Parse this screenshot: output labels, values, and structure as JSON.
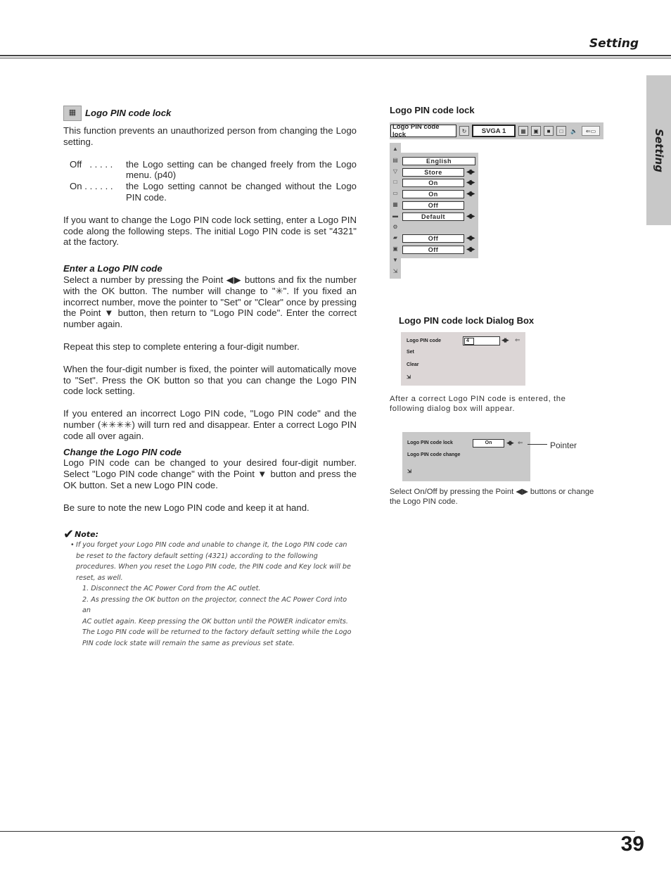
{
  "header": {
    "section_title": "Setting"
  },
  "side_tab": {
    "label": "Setting"
  },
  "left": {
    "section": {
      "icon": "logo-pin-lock-icon",
      "title": "Logo PIN code lock",
      "intro": "This function prevents an unauthorized person from changing the Logo setting.",
      "options": [
        {
          "key": "Off   . . . . .",
          "desc": "the Logo setting can be changed freely from the Logo menu.  (p40)"
        },
        {
          "key": "On . . . . . .",
          "desc": "the Logo setting cannot be changed without the Logo PIN code."
        }
      ],
      "para2": "If you want to change the Logo PIN code lock setting, enter a Logo PIN code along the following steps. The initial Logo PIN code is set \"4321\" at the factory."
    },
    "enter": {
      "title": "Enter a Logo PIN code",
      "p1": "Select a number by pressing the Point ◀▶ buttons and fix the number with the OK button.  The number will change to \"✳\".  If you fixed an incorrect number, move the pointer to \"Set\" or \"Clear\" once by pressing the Point ▼ button, then return to \"Logo PIN code\".  Enter the correct number again.",
      "p2": "Repeat this step to complete entering a four-digit number.",
      "p3": "When the four-digit number is fixed, the pointer will automatically move to \"Set\".  Press the OK button so that you can change the Logo PIN code lock setting.",
      "p4": "If you entered an incorrect Logo PIN code, \"Logo PIN code\" and the number (✳✳✳✳) will turn red and disappear.  Enter a correct Logo PIN code all over again."
    },
    "change": {
      "title": "Change the Logo PIN code",
      "p1": "Logo PIN code can be changed to your desired four-digit number. Select \"Logo PIN code change\" with the Point ▼ button and press the OK button. Set a new Logo PIN code.",
      "p2": "Be sure to note the new Logo PIN code and keep it at hand."
    },
    "note": {
      "title": "Note:",
      "bullet": "If you forget your Logo PIN code and unable to change it, the Logo PIN code can be reset to the factory default setting (4321) according to the following procedures. When you reset the Logo PIN code, the PIN code and Key lock will be reset, as well.",
      "step1": "1. Disconnect the AC Power Cord from the AC outlet.",
      "step2a": "2. As pressing the OK button on the projector, connect the AC Power Cord into an",
      "step2b": "AC outlet again.  Keep pressing the OK button until the POWER indicator emits.",
      "step2c": "The Logo PIN code will be returned to the factory default setting while the Logo PIN code lock state will remain the same as previous set state."
    }
  },
  "right": {
    "menu_label": "Logo PIN code lock",
    "menubar": {
      "selected_item": "Logo PIN code lock",
      "source": "SVGA 1",
      "icons": [
        "pc-adjust-icon",
        "image-select-icon",
        "image-adjust-icon",
        "screen-icon",
        "setting-icon",
        "sound-icon",
        "setting-selected-icon"
      ]
    },
    "submenu": {
      "rows": [
        {
          "icon": "▲",
          "value": null,
          "arrows": false
        },
        {
          "icon": "▤",
          "value": "English",
          "arrows": false
        },
        {
          "icon": "▽",
          "value": "Store",
          "arrows": true
        },
        {
          "icon": "□",
          "value": "On",
          "arrows": true
        },
        {
          "icon": "▭",
          "value": "On",
          "arrows": true
        },
        {
          "icon": "▦",
          "value": "Off",
          "arrows": false
        },
        {
          "icon": "▬",
          "value": "Default",
          "arrows": true
        },
        {
          "icon": "⚙",
          "value": null,
          "arrows": false
        },
        {
          "icon": "▰",
          "value": "Off",
          "arrows": true
        },
        {
          "icon": "▣",
          "value": "Off",
          "arrows": true
        },
        {
          "icon": "▼",
          "value": null,
          "arrows": false
        },
        {
          "icon": "⇲",
          "value": null,
          "arrows": false
        }
      ]
    },
    "dialog_label": "Logo PIN code lock Dialog Box",
    "dialog1": {
      "field_label": "Logo PIN code",
      "field_value": "4",
      "set": "Set",
      "clear": "Clear"
    },
    "dialog1_caption": "After a correct Logo PIN code is entered, the following dialog box will appear.",
    "dialog2": {
      "lock_label": "Logo PIN code lock",
      "lock_value": "On",
      "change_label": "Logo PIN code change"
    },
    "pointer_label": "Pointer",
    "dialog2_caption": "Select On/Off by pressing the Point ◀▶ buttons or change the Logo PIN code."
  },
  "footer": {
    "page_number": "39"
  }
}
